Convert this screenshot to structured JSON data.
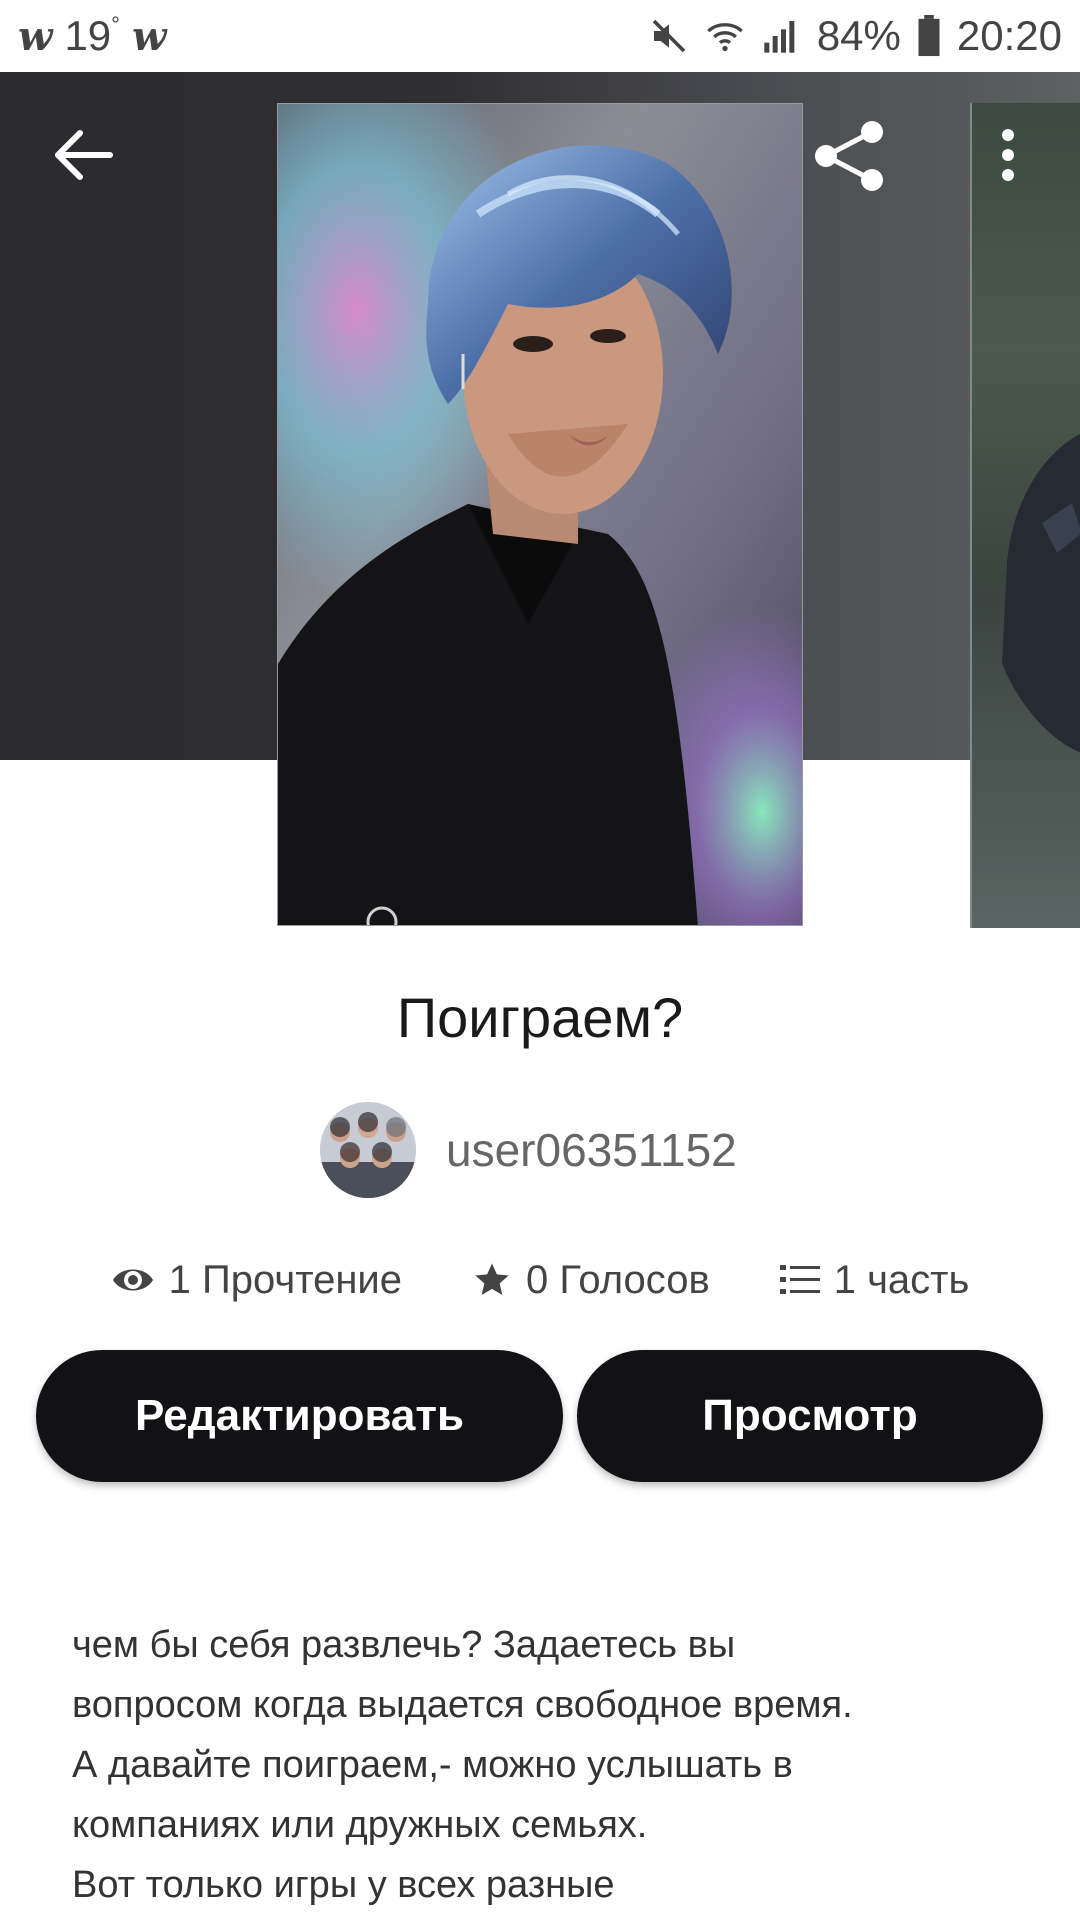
{
  "status_bar": {
    "app_badge_left": "w",
    "temperature": "19",
    "temperature_unit": "°",
    "app_badge_right": "w",
    "battery": "84%",
    "time": "20:20"
  },
  "story": {
    "title": "Поиграем?",
    "author": "user06351152",
    "stats": {
      "reads": "1 Прочтение",
      "votes": "0 Голосов",
      "parts": "1 часть"
    }
  },
  "actions": {
    "edit_label": "Редактировать",
    "preview_label": "Просмотр"
  },
  "description": [
    "чем бы себя развлечь? Задаетесь вы",
    "вопросом когда выдается свободное время.",
    "А давайте поиграем,- можно услышать в",
    "компаниях или дружных семьях.",
    "Вот только игры у всех разные"
  ],
  "icons": {
    "back": "arrow-left-icon",
    "share": "share-icon",
    "more": "more-vertical-icon",
    "reads": "eye-icon",
    "votes": "star-icon",
    "parts": "list-icon"
  }
}
